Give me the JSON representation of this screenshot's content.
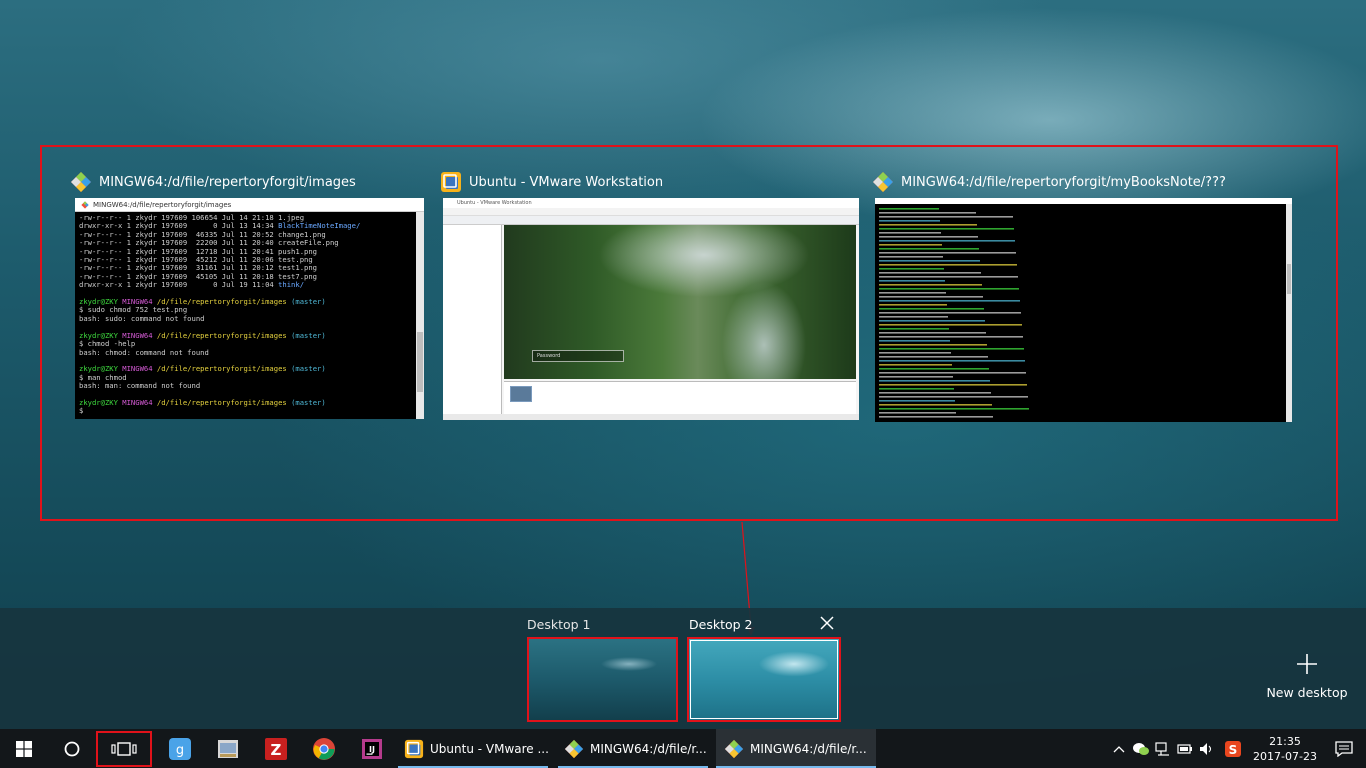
{
  "windows": [
    {
      "title": "MINGW64:/d/file/repertoryforgit/images"
    },
    {
      "title": "Ubuntu - VMware Workstation"
    },
    {
      "title": "MINGW64:/d/file/repertoryforgit/myBooksNote/???"
    }
  ],
  "terminal1": {
    "bar_title": "MINGW64:/d/file/repertoryforgit/images",
    "lines": [
      {
        "text": "-rw-r--r-- 1 zkydr 197609 106654 Jul 14 21:18 1.jpeg",
        "cls": ""
      },
      {
        "text": "drwxr-xr-x 1 zkydr 197609      0 Jul 13 14:34 ",
        "cls": "",
        "tail": "BlackTimeNoteImage/",
        "tailcls": "c-b"
      },
      {
        "text": "-rw-r--r-- 1 zkydr 197609  46335 Jul 11 20:52 change1.png",
        "cls": ""
      },
      {
        "text": "-rw-r--r-- 1 zkydr 197609  22200 Jul 11 20:40 createFile.png",
        "cls": ""
      },
      {
        "text": "-rw-r--r-- 1 zkydr 197609  12718 Jul 11 20:41 push1.png",
        "cls": ""
      },
      {
        "text": "-rw-r--r-- 1 zkydr 197609  45212 Jul 11 20:06 test.png",
        "cls": ""
      },
      {
        "text": "-rw-r--r-- 1 zkydr 197609  31161 Jul 11 20:12 test1.png",
        "cls": ""
      },
      {
        "text": "-rw-r--r-- 1 zkydr 197609  45105 Jul 11 20:18 test7.png",
        "cls": ""
      },
      {
        "text": "drwxr-xr-x 1 zkydr 197609      0 Jul 19 11:04 ",
        "cls": "",
        "tail": "think/",
        "tailcls": "c-b"
      },
      {
        "text": "",
        "cls": ""
      },
      {
        "prompt": true
      },
      {
        "text": "$ sudo chmod 752 test.png",
        "cls": ""
      },
      {
        "text": "bash: sudo: command not found",
        "cls": ""
      },
      {
        "text": "",
        "cls": ""
      },
      {
        "prompt": true
      },
      {
        "text": "$ chmod -help",
        "cls": ""
      },
      {
        "text": "bash: chmod: command not found",
        "cls": ""
      },
      {
        "text": "",
        "cls": ""
      },
      {
        "prompt": true
      },
      {
        "text": "$ man chmod",
        "cls": ""
      },
      {
        "text": "bash: man: command not found",
        "cls": ""
      },
      {
        "text": "",
        "cls": ""
      },
      {
        "prompt": true
      },
      {
        "text": "$ ",
        "cls": ""
      }
    ],
    "prompt_user": "zkydr@ZKY",
    "prompt_env": "MINGW64",
    "prompt_path": "/d/file/repertoryforgit/images",
    "prompt_branch": "(master)"
  },
  "vmware": {
    "title_text": "Ubuntu - VMware Workstation",
    "password_placeholder": "Password"
  },
  "desktops": [
    {
      "label": "Desktop 1"
    },
    {
      "label": "Desktop 2"
    }
  ],
  "new_desktop_label": "New desktop",
  "taskbar": {
    "apps": [
      {
        "label": "Ubuntu - VMware ..."
      },
      {
        "label": "MINGW64:/d/file/r..."
      },
      {
        "label": "MINGW64:/d/file/r..."
      }
    ],
    "clock_time": "21:35",
    "clock_date": "2017-07-23"
  }
}
